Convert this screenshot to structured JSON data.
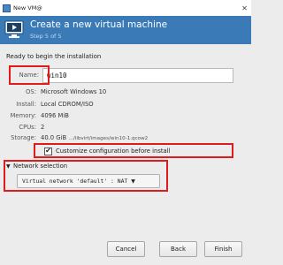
{
  "window": {
    "title": "New VM@",
    "icon": "monitor-icon"
  },
  "header": {
    "title": "Create a new virtual machine",
    "subtitle": "Step 5 of 5"
  },
  "ready_text": "Ready to begin the installation",
  "name": {
    "label": "Name:",
    "value": "win10"
  },
  "info": [
    {
      "label": "OS:",
      "value": "Microsoft Windows 10"
    },
    {
      "label": "Install:",
      "value": "Local CDROM/ISO"
    },
    {
      "label": "Memory:",
      "value": "4096 MiB"
    },
    {
      "label": "CPUs:",
      "value": "2"
    },
    {
      "label": "Storage:",
      "value": "40.0 GiB",
      "path": "…/libvirt/images/win10-1.qcow2"
    }
  ],
  "customize": {
    "label": "Customize configuration before install",
    "checked": true,
    "check_mark": "✔"
  },
  "network": {
    "label": "Network selection",
    "value": "Virtual network 'default' : NAT",
    "expander_icon": "triangle-down-icon"
  },
  "buttons": {
    "cancel": "Cancel",
    "back": "Back",
    "finish": "Finish"
  },
  "colors": {
    "header_bg": "#3a7ab6",
    "highlight": "#e01b1b"
  }
}
